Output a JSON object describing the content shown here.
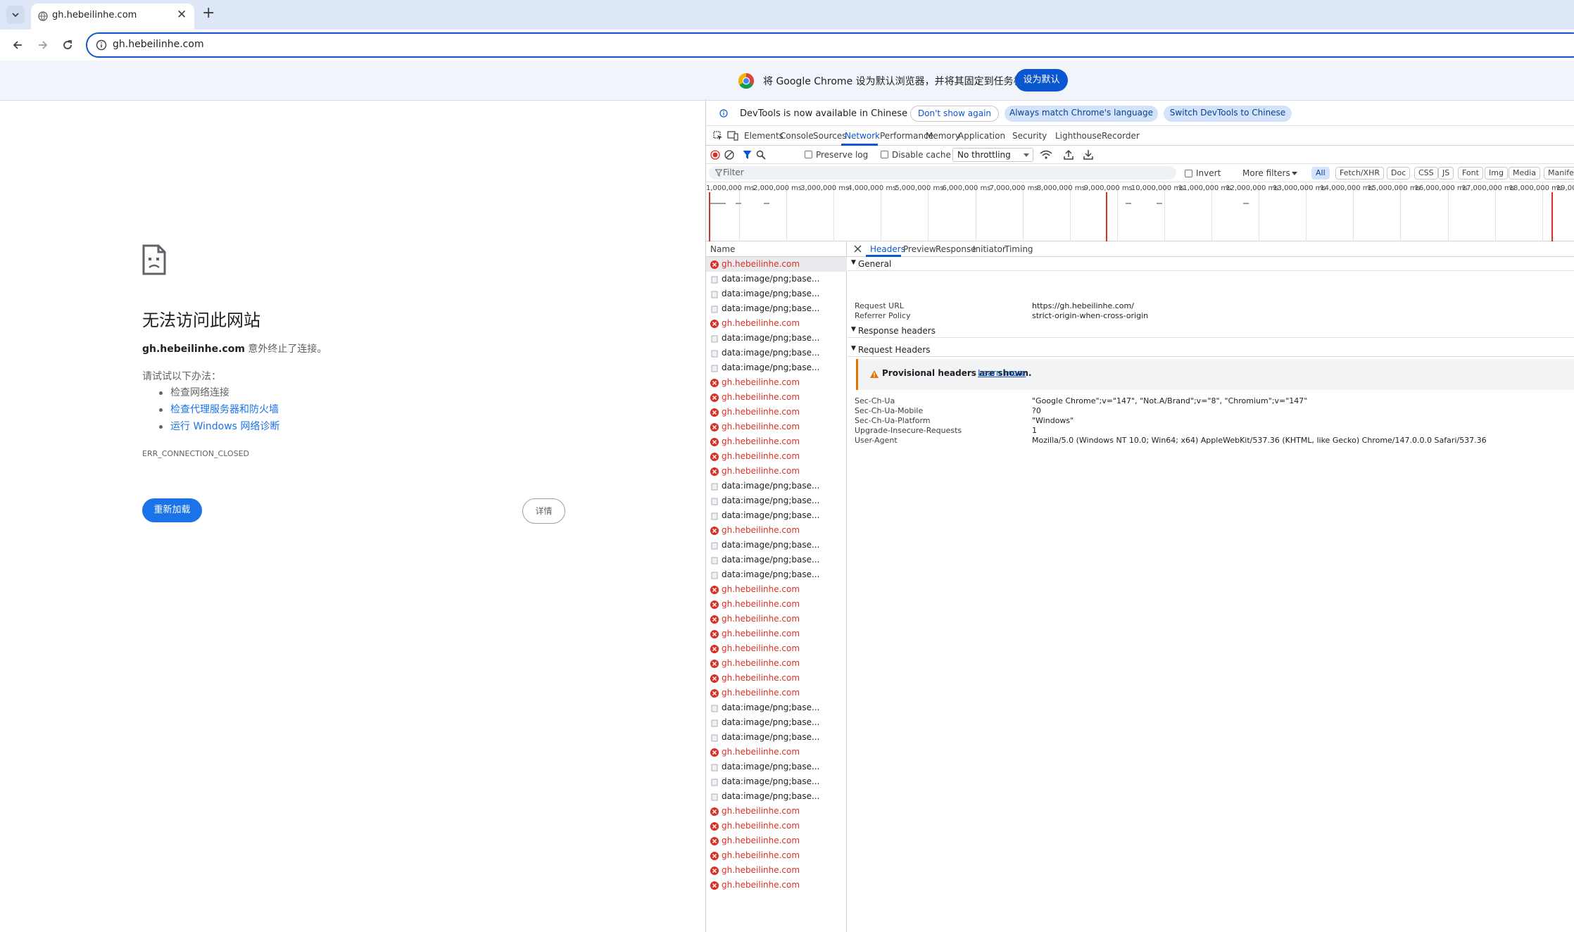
{
  "tab": {
    "title": "gh.hebeilinhe.com",
    "close": "✕",
    "new_tab": "+"
  },
  "toolbar": {
    "url": "gh.hebeilinhe.com"
  },
  "infobar": {
    "text": "将 Google Chrome 设为默认浏览器，并将其固定到任务栏",
    "button": "设为默认"
  },
  "error": {
    "title": "无法访问此网站",
    "host": "gh.hebeilinhe.com",
    "message_suffix": " 意外终止了连接。",
    "try_label": "请试试以下办法：",
    "suggestions": [
      "检查网络连接",
      "检查代理服务器和防火墙",
      "运行 Windows 网络诊断"
    ],
    "code": "ERR_CONNECTION_CLOSED",
    "reload": "重新加载",
    "details": "详情"
  },
  "devtools": {
    "notice": {
      "text": "DevTools is now available in Chinese",
      "dont_show": "Don't show again",
      "always_match": "Always match Chrome's language",
      "switch": "Switch DevTools to Chinese"
    },
    "tabs": [
      "Elements",
      "Console",
      "Sources",
      "Network",
      "Performance",
      "Memory",
      "Application",
      "Security",
      "Lighthouse",
      "Recorder"
    ],
    "active_tab": "Network",
    "tools": {
      "preserve_log": "Preserve log",
      "disable_cache": "Disable cache",
      "throttling": "No throttling"
    },
    "filter": {
      "placeholder": "Filter",
      "invert": "Invert",
      "more_filters": "More filters",
      "types": [
        "All",
        "Fetch/XHR",
        "Doc",
        "CSS",
        "JS",
        "Font",
        "Img",
        "Media",
        "Manife"
      ],
      "active_type": "All"
    },
    "timeline_ticks": [
      "1,000,000 ms",
      "2,000,000 ms",
      "3,000,000 ms",
      "4,000,000 ms",
      "5,000,000 ms",
      "6,000,000 ms",
      "7,000,000 ms",
      "8,000,000 ms",
      "9,000,000 ms",
      "10,000,000 ms",
      "11,000,000 ms",
      "12,000,000 ms",
      "13,000,000 ms",
      "14,000,000 ms",
      "15,000,000 ms",
      "16,000,000 ms",
      "17,000,000 ms",
      "18,000,000 ms",
      "19,00"
    ],
    "list_header": "Name",
    "requests": [
      {
        "name": "gh.hebeilinhe.com",
        "error": true
      },
      {
        "name": "data:image/png;base...",
        "error": false
      },
      {
        "name": "data:image/png;base...",
        "error": false
      },
      {
        "name": "data:image/png;base...",
        "error": false
      },
      {
        "name": "gh.hebeilinhe.com",
        "error": true
      },
      {
        "name": "data:image/png;base...",
        "error": false
      },
      {
        "name": "data:image/png;base...",
        "error": false
      },
      {
        "name": "data:image/png;base...",
        "error": false
      },
      {
        "name": "gh.hebeilinhe.com",
        "error": true
      },
      {
        "name": "gh.hebeilinhe.com",
        "error": true
      },
      {
        "name": "gh.hebeilinhe.com",
        "error": true
      },
      {
        "name": "gh.hebeilinhe.com",
        "error": true
      },
      {
        "name": "gh.hebeilinhe.com",
        "error": true
      },
      {
        "name": "gh.hebeilinhe.com",
        "error": true
      },
      {
        "name": "gh.hebeilinhe.com",
        "error": true
      },
      {
        "name": "data:image/png;base...",
        "error": false
      },
      {
        "name": "data:image/png;base...",
        "error": false
      },
      {
        "name": "data:image/png;base...",
        "error": false
      },
      {
        "name": "gh.hebeilinhe.com",
        "error": true
      },
      {
        "name": "data:image/png;base...",
        "error": false
      },
      {
        "name": "data:image/png;base...",
        "error": false
      },
      {
        "name": "data:image/png;base...",
        "error": false
      },
      {
        "name": "gh.hebeilinhe.com",
        "error": true
      },
      {
        "name": "gh.hebeilinhe.com",
        "error": true
      },
      {
        "name": "gh.hebeilinhe.com",
        "error": true
      },
      {
        "name": "gh.hebeilinhe.com",
        "error": true
      },
      {
        "name": "gh.hebeilinhe.com",
        "error": true
      },
      {
        "name": "gh.hebeilinhe.com",
        "error": true
      },
      {
        "name": "gh.hebeilinhe.com",
        "error": true
      },
      {
        "name": "gh.hebeilinhe.com",
        "error": true
      },
      {
        "name": "data:image/png;base...",
        "error": false
      },
      {
        "name": "data:image/png;base...",
        "error": false
      },
      {
        "name": "data:image/png;base...",
        "error": false
      },
      {
        "name": "gh.hebeilinhe.com",
        "error": true
      },
      {
        "name": "data:image/png;base...",
        "error": false
      },
      {
        "name": "data:image/png;base...",
        "error": false
      },
      {
        "name": "data:image/png;base...",
        "error": false
      },
      {
        "name": "gh.hebeilinhe.com",
        "error": true
      },
      {
        "name": "gh.hebeilinhe.com",
        "error": true
      },
      {
        "name": "gh.hebeilinhe.com",
        "error": true
      },
      {
        "name": "gh.hebeilinhe.com",
        "error": true
      },
      {
        "name": "gh.hebeilinhe.com",
        "error": true
      },
      {
        "name": "gh.hebeilinhe.com",
        "error": true
      }
    ],
    "detail_tabs": [
      "Headers",
      "Preview",
      "Response",
      "Initiator",
      "Timing"
    ],
    "general_title": "General",
    "general": [
      {
        "key": "Request URL",
        "value": "https://gh.hebeilinhe.com/"
      },
      {
        "key": "Referrer Policy",
        "value": "strict-origin-when-cross-origin"
      }
    ],
    "response_headers_title": "Response headers",
    "request_headers_title": "Request Headers",
    "provisional": {
      "text": "Provisional headers are shown.",
      "link": "Learn more"
    },
    "request_headers": [
      {
        "key": "Sec-Ch-Ua",
        "value": "\"Google Chrome\";v=\"147\", \"Not.A/Brand\";v=\"8\", \"Chromium\";v=\"147\""
      },
      {
        "key": "Sec-Ch-Ua-Mobile",
        "value": "?0"
      },
      {
        "key": "Sec-Ch-Ua-Platform",
        "value": "\"Windows\""
      },
      {
        "key": "Upgrade-Insecure-Requests",
        "value": "1"
      },
      {
        "key": "User-Agent",
        "value": "Mozilla/5.0 (Windows NT 10.0; Win64; x64) AppleWebKit/537.36 (KHTML, like Gecko) Chrome/147.0.0.0 Safari/537.36"
      }
    ]
  }
}
